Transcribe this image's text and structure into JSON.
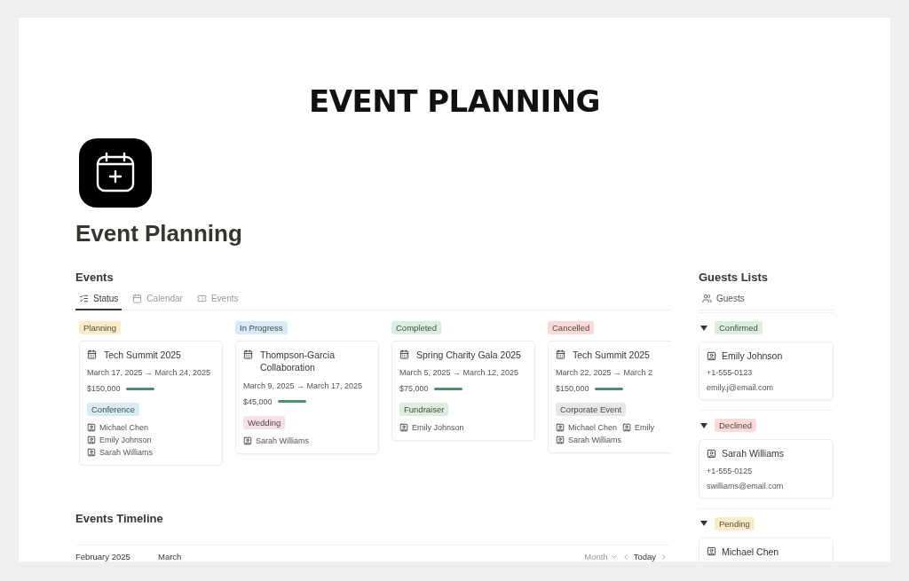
{
  "header": {
    "banner": "EVENT PLANNING",
    "title": "Event Planning"
  },
  "events": {
    "heading": "Events",
    "tabs": [
      {
        "label": "Status",
        "kind": "list",
        "selected": true
      },
      {
        "label": "Calendar",
        "kind": "calendar",
        "selected": false
      },
      {
        "label": "Events",
        "kind": "table",
        "selected": false
      }
    ],
    "columns": [
      {
        "status": "Planning",
        "color": "#fbecc8",
        "cards": [
          {
            "title": "Tech Summit 2025",
            "dates": "March 17, 2025 → March 24, 2025",
            "budget": "$150,000",
            "level": 1,
            "tag": {
              "label": "Conference",
              "color": "#d9ecf4"
            },
            "people": [
              "Michael Chen",
              "Emily Johnson",
              "Sarah Williams"
            ]
          }
        ]
      },
      {
        "status": "In Progress",
        "color": "#d7eaf5",
        "cards": [
          {
            "title": "Thompson-Garcia Collaboration",
            "dates": "March 9, 2025 → March 17, 2025",
            "budget": "$45,000",
            "level": 1,
            "tag": {
              "label": "Wedding",
              "color": "#f8e0e8"
            },
            "people": [
              "Sarah Williams"
            ]
          }
        ]
      },
      {
        "status": "Completed",
        "color": "#dcefdf",
        "cards": [
          {
            "title": "Spring Charity Gala 2025",
            "dates": "March 5, 2025 → March 12, 2025",
            "budget": "$75,000",
            "level": 1,
            "tag": {
              "label": "Fundraiser",
              "color": "#dcefdf"
            },
            "people": [
              "Emily Johnson"
            ]
          }
        ]
      },
      {
        "status": "Cancelled",
        "color": "#fbdad8",
        "cards": [
          {
            "title": "Tech Summit 2025",
            "dates": "March 22, 2025 → March 2",
            "budget": "$150,000",
            "level": 1,
            "tag": {
              "label": "Corporate Event",
              "color": "#e7e7e5"
            },
            "people": [
              "Michael Chen",
              "Emily",
              "Sarah Williams"
            ]
          }
        ]
      }
    ]
  },
  "timeline": {
    "heading": "Events Timeline",
    "months": [
      "February 2025",
      "March"
    ],
    "view": "Month",
    "today": "Today"
  },
  "guests": {
    "heading": "Guests Lists",
    "tab": "Guests",
    "groups": [
      {
        "status": "Confirmed",
        "color": "#dcefdf",
        "expanded": true,
        "guests": [
          {
            "name": "Emily Johnson",
            "phone": "+1-555-0123",
            "email": "emily.j@email.com"
          }
        ]
      },
      {
        "status": "Declined",
        "color": "#fbdad8",
        "expanded": true,
        "guests": [
          {
            "name": "Sarah Williams",
            "phone": "+1-555-0125",
            "email": "swilliams@email.com"
          }
        ]
      },
      {
        "status": "Pending",
        "color": "#fbecc8",
        "expanded": true,
        "guests": [
          {
            "name": "Michael Chen"
          }
        ]
      }
    ]
  }
}
